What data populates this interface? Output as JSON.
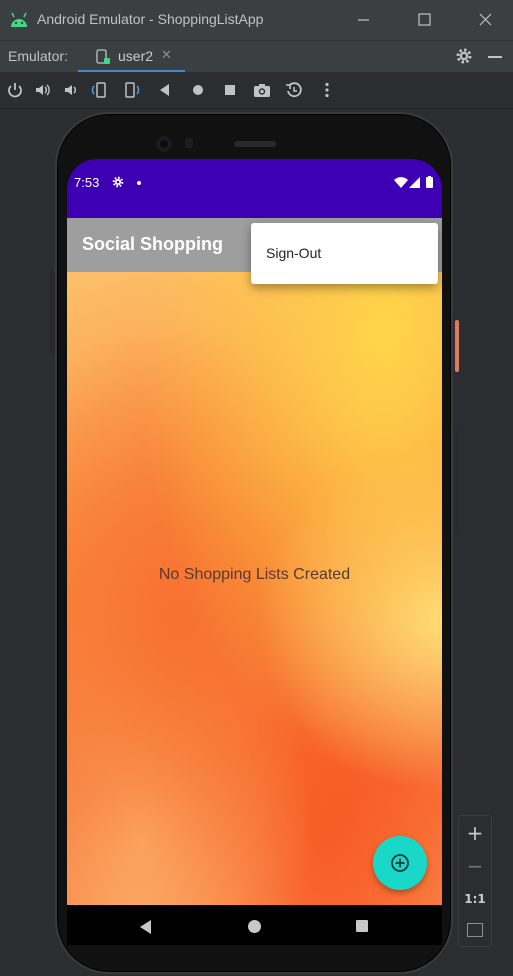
{
  "window": {
    "title": "Android Emulator - ShoppingListApp"
  },
  "tabrow": {
    "label": "Emulator:",
    "tab_label": "user2",
    "close_glyph": "✕"
  },
  "toolbar": {
    "icons": [
      "power-icon",
      "volume-up-icon",
      "volume-down-icon",
      "rotate-left-icon",
      "rotate-right-icon",
      "back-icon",
      "home-icon",
      "overview-icon",
      "screenshot-icon",
      "snapshot-icon",
      "more-icon"
    ]
  },
  "device": {
    "status_time": "7:53",
    "app_title": "Social Shopping",
    "empty_message": "No Shopping Lists Created",
    "menu": {
      "items": [
        "Sign-Out"
      ]
    },
    "colors": {
      "status_bar": "#3d00b3",
      "app_bar": "#9e9e9e",
      "fab": "#1ad8c8"
    }
  },
  "zoom": {
    "in_label": "+",
    "out_label": "−",
    "actual_label": "1:1"
  },
  "colors": {
    "accent": "#4a88c7",
    "android_green": "#3ddc84"
  }
}
